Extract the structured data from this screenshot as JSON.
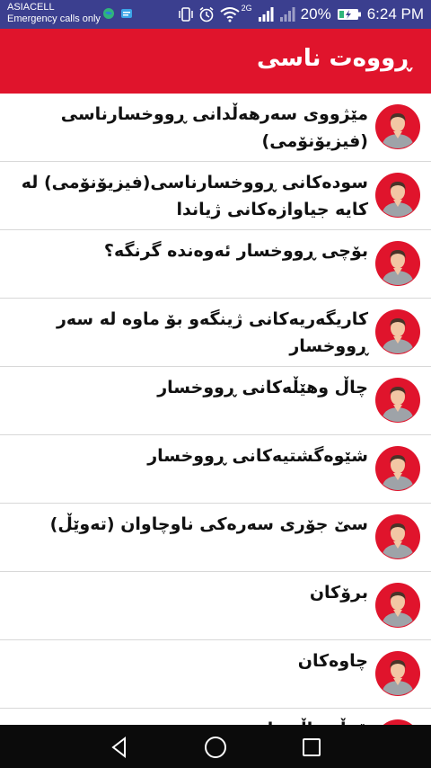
{
  "status_bar": {
    "carrier": "ASIACELL",
    "emergency": "Emergency calls only",
    "signal_tag": "2G",
    "battery": "20%",
    "time": "6:24 PM"
  },
  "app_bar": {
    "title": "ڕووەت ناسی"
  },
  "list": {
    "items": [
      {
        "label": "مێژووی سەرهەڵدانی ڕووخسارناسی (فیزیۆنۆمی)"
      },
      {
        "label": "سودەکانی ڕووخسارناسی(فیزیۆنۆمی) لە کایە جیاوازەکانی ژیاندا"
      },
      {
        "label": "بۆچی ڕووخسار ئەوەندە گرنگە؟"
      },
      {
        "label": "کاریگەریەکانی ژینگەو بۆ ماوە لە سەر ڕووخسار"
      },
      {
        "label": "چاڵ وهێڵەکانی ڕووخسار"
      },
      {
        "label": "شێوەگشتیەکانی ڕووخسار"
      },
      {
        "label": "سێ جۆری سەرەکی ناوچاوان (تەوێڵ)"
      },
      {
        "label": "برۆکان"
      },
      {
        "label": "چاوەکان"
      },
      {
        "label": "قوڵ چاڵ چاو"
      }
    ],
    "avatar_icon": "user-avatar-icon",
    "avatar_color": "#e0142c"
  },
  "nav_bar": {
    "back_icon": "back-triangle-icon",
    "home_icon": "home-circle-icon",
    "recents_icon": "recents-square-icon"
  },
  "colors": {
    "status_bar": "#3b3f8f",
    "app_bar": "#e0142c",
    "nav_bar": "#0b0b0b"
  }
}
